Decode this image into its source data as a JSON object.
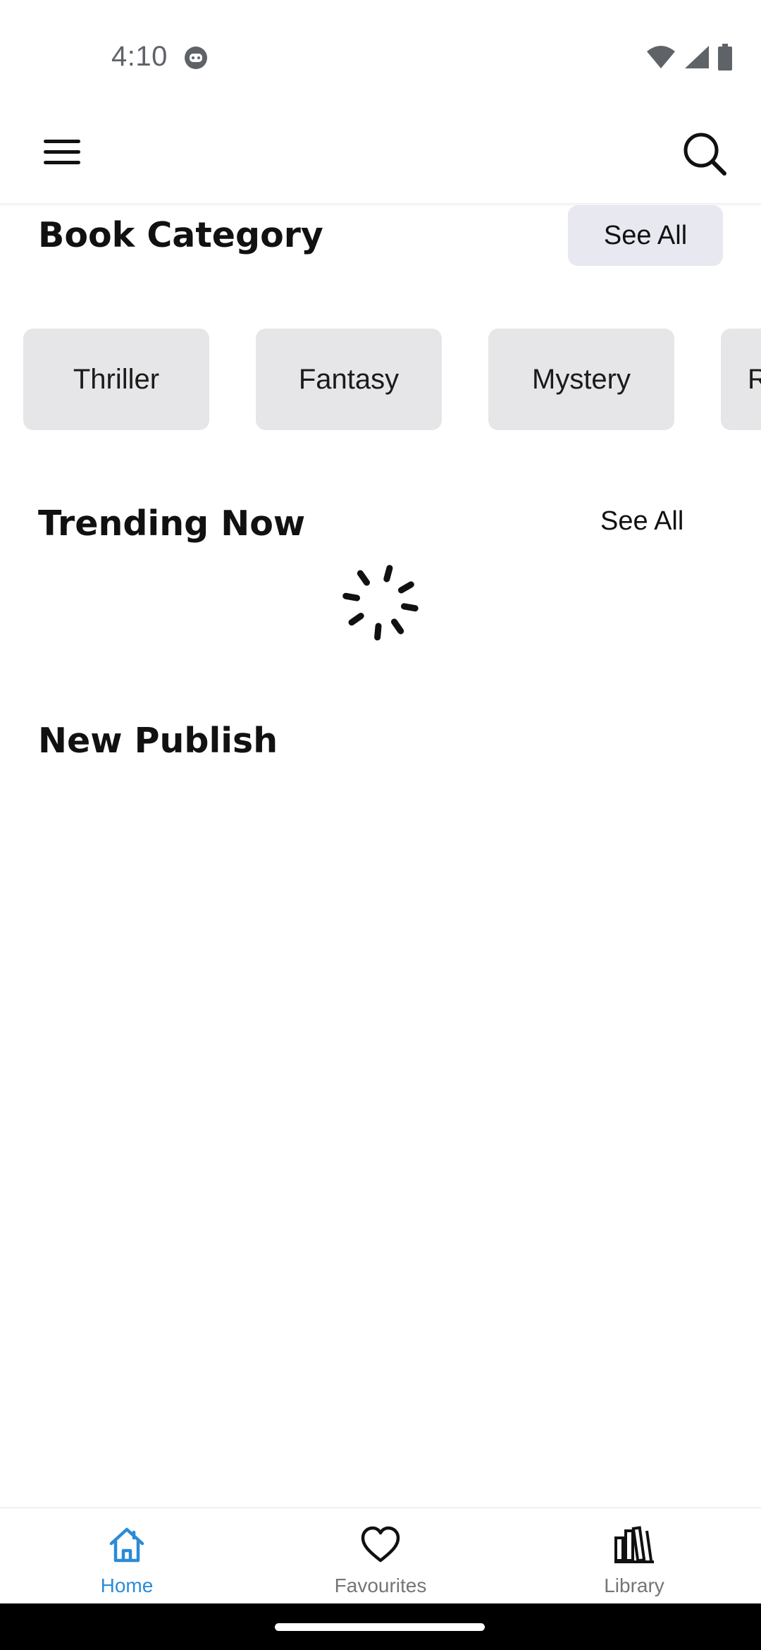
{
  "status_bar": {
    "time": "4:10",
    "icons": [
      "face-icon",
      "wifi-icon",
      "signal-icon",
      "battery-icon"
    ]
  },
  "app_bar": {
    "menu_icon": "menu-icon",
    "search_icon": "search-icon"
  },
  "book_category": {
    "title": "Book Category",
    "see_all": "See All",
    "chips": [
      "Thriller",
      "Fantasy",
      "Mystery",
      "R"
    ]
  },
  "trending": {
    "title": "Trending Now",
    "see_all": "See All",
    "loading_icon": "loading-spinner-icon"
  },
  "new_publish": {
    "title": "New Publish"
  },
  "bottom_nav": {
    "items": [
      {
        "label": "Home",
        "icon": "home-icon",
        "active": true
      },
      {
        "label": "Favourites",
        "icon": "heart-icon",
        "active": false
      },
      {
        "label": "Library",
        "icon": "library-icon",
        "active": false
      }
    ]
  },
  "colors": {
    "accent": "#2b8bd6",
    "chip_bg": "#e6e6e8",
    "see_all_bg": "#e7e8f0",
    "inactive_nav": "#757575"
  }
}
